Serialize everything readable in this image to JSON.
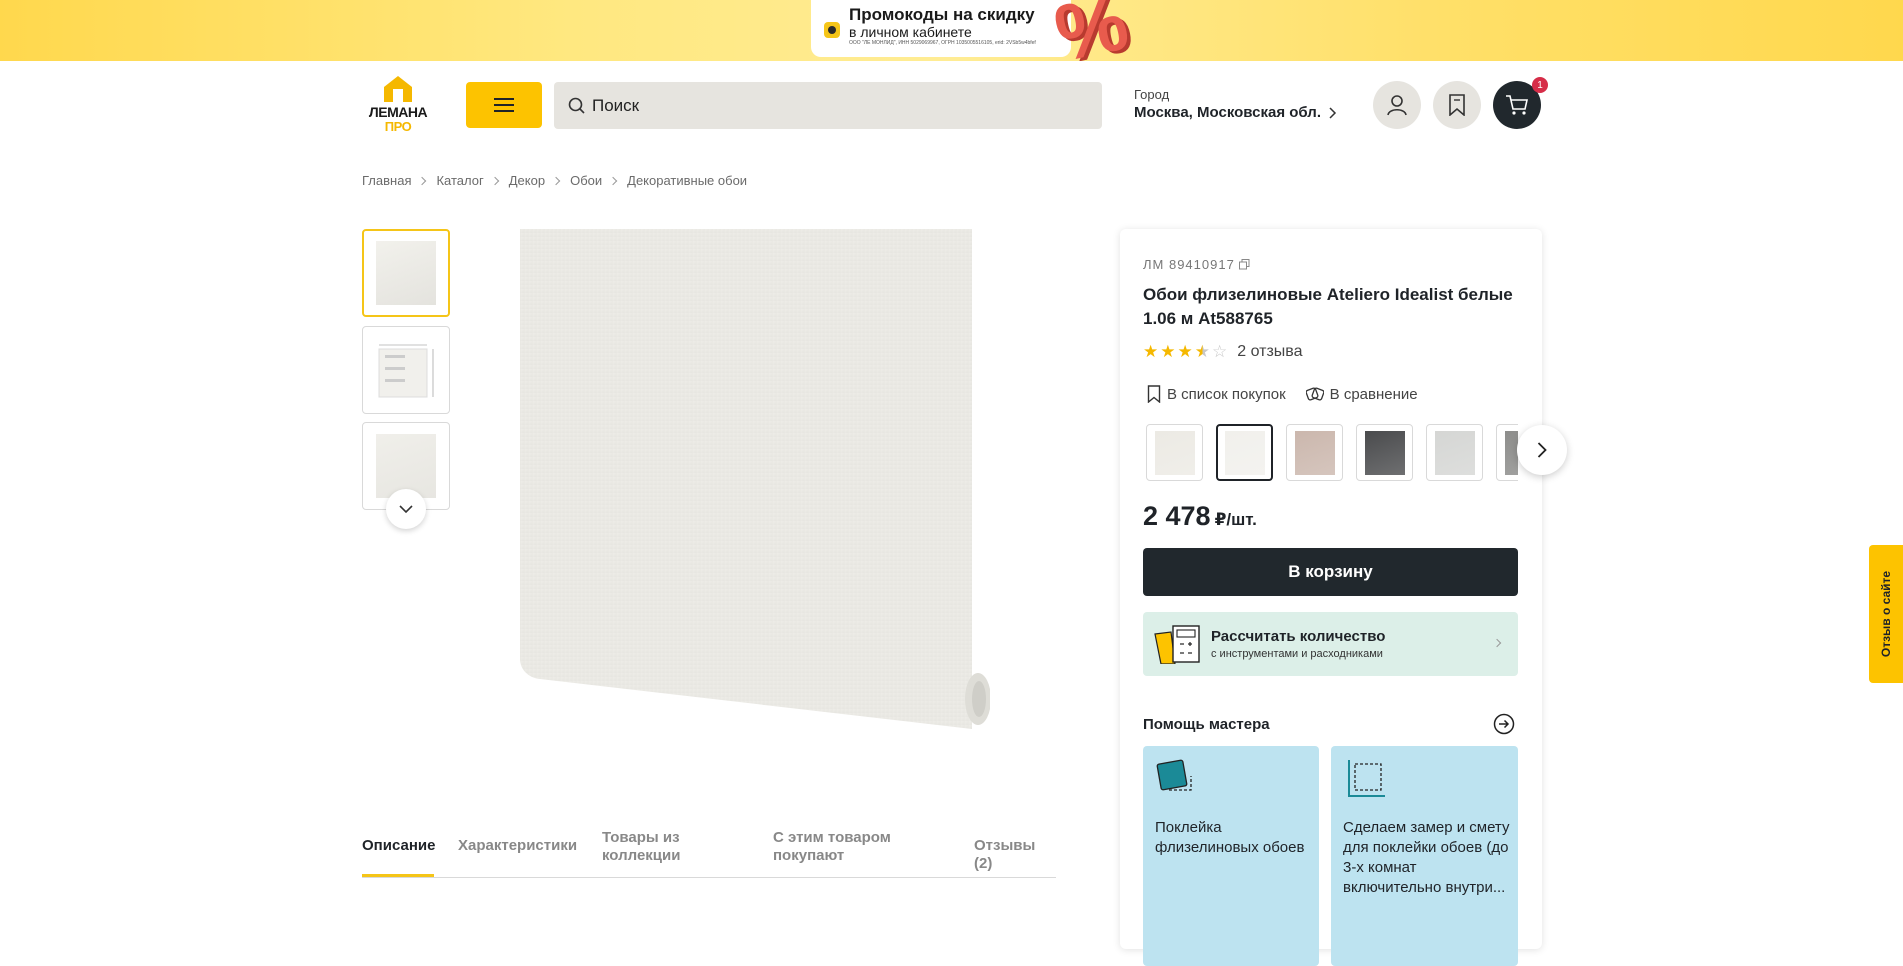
{
  "promo": {
    "title": "Промокоды на скидку",
    "subtitle": "в личном кабинете",
    "legal": "ООО \"ЛЕ МОНЛИД\", ИНН 5029069967, ОГРН 1035005516105, erid: 2VSb5w4bfef",
    "percent_glyph": "%"
  },
  "header": {
    "logo_line1": "ЛЕМАНА",
    "logo_line2": "ПРО",
    "search_placeholder": "Поиск",
    "city_label": "Город",
    "city_value": "Москва, Московская обл.",
    "cart_count": "1"
  },
  "breadcrumb": [
    "Главная",
    "Каталог",
    "Декор",
    "Обои",
    "Декоративные обои"
  ],
  "product": {
    "sku": "ЛМ 89410917",
    "title": "Обои флизелиновые Ateliero Idealist белые 1.06 м At588765",
    "rating": 3.5,
    "rating_max": 5,
    "reviews": "2 отзыва",
    "action_list": "В список покупок",
    "action_compare": "В сравнение",
    "price_value": "2 478",
    "price_unit": "₽/шт.",
    "cart_button": "В корзину",
    "calc_title": "Рассчитать количество",
    "calc_subtitle": "с инструментами и расходниками",
    "help_title": "Помощь мастера",
    "services": [
      "Поклейка флизелиновых обоев",
      "Сделаем замер и смету для поклейки обоев (до 3-х комнат включительно внутри..."
    ],
    "swatch_colors": [
      "#eceae4",
      "#f1f0ec",
      "#cbb7ad",
      "#4a4b4d",
      "#d5d6d4",
      "#8d8d8b"
    ]
  },
  "tabs": [
    {
      "label": "Описание",
      "active": true
    },
    {
      "label": "Характеристики",
      "active": false
    },
    {
      "label": "Товары из коллекции",
      "active": false
    },
    {
      "label": "С этим товаром покупают",
      "active": false
    },
    {
      "label": "Отзывы (2)",
      "active": false
    }
  ],
  "feedback_label": "Отзыв о сайте",
  "colors": {
    "accent_yellow": "#fdc300",
    "dark": "#21282d",
    "calc_bg": "#dcefe8",
    "service_bg": "#bde3f0"
  }
}
